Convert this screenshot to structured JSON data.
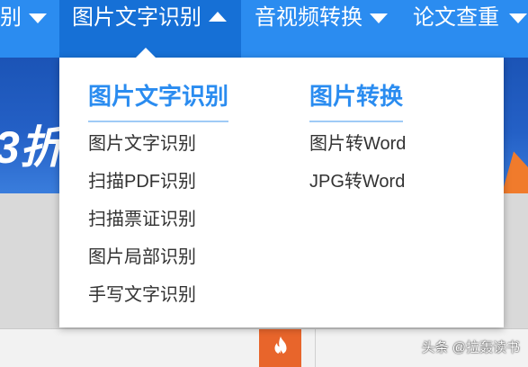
{
  "nav": {
    "items": [
      {
        "label": "别",
        "arrow": "down",
        "active": false
      },
      {
        "label": "图片文字识别",
        "arrow": "up",
        "active": true
      },
      {
        "label": "音视频转换",
        "arrow": "down",
        "active": false
      },
      {
        "label": "论文查重",
        "arrow": "down",
        "active": false
      }
    ]
  },
  "banner": {
    "promo_text": "3折"
  },
  "dropdown": {
    "columns": [
      {
        "heading": "图片文字识别",
        "items": [
          "图片文字识别",
          "扫描PDF识别",
          "扫描票证识别",
          "图片局部识别",
          "手写文字识别"
        ]
      },
      {
        "heading": "图片转换",
        "items": [
          "图片转Word",
          "JPG转Word"
        ]
      }
    ]
  },
  "bottom": {
    "button_icon": "flame-icon"
  },
  "watermark": {
    "text": "头条 @拉轰读书"
  },
  "colors": {
    "nav_bg": "#2b8cf0",
    "nav_active_bg": "#1670d6",
    "heading": "#2a8cf0",
    "underline": "#9fcbf6",
    "accent_orange": "#e8652b"
  }
}
